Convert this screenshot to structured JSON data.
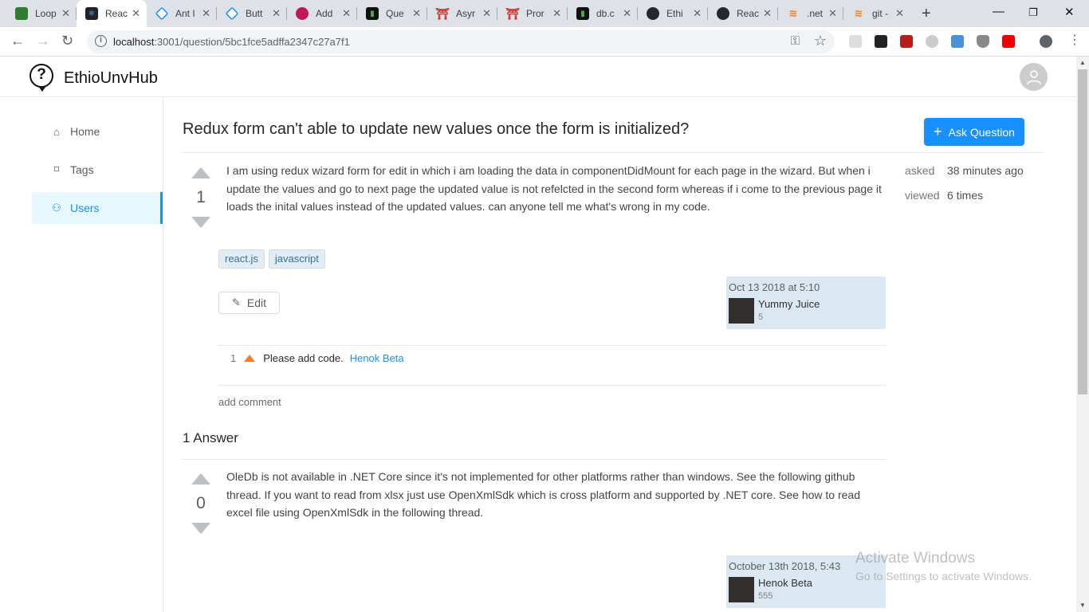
{
  "browser": {
    "tabs": [
      {
        "title": "Loop",
        "color": "#2e7d32"
      },
      {
        "title": "Reac",
        "color": "#20232a"
      },
      {
        "title": "Ant I",
        "color": "#1890ff"
      },
      {
        "title": "Butt",
        "color": "#1890ff"
      },
      {
        "title": "Add",
        "color": "#c2185b"
      },
      {
        "title": "Que",
        "color": "#1b5e20"
      },
      {
        "title": "Asyr",
        "color": "#d32f2f"
      },
      {
        "title": "Pror",
        "color": "#d32f2f"
      },
      {
        "title": "db.c",
        "color": "#1b5e20"
      },
      {
        "title": "Ethi",
        "color": "#24292e"
      },
      {
        "title": "Reac",
        "color": "#24292e"
      },
      {
        "title": ".net",
        "color": "#f48024"
      },
      {
        "title": "git -",
        "color": "#f48024"
      }
    ],
    "active_tab": 1,
    "url_host": "localhost",
    "url_rest": ":3001/question/5bc1fce5adffa2347c27a7f1"
  },
  "app": {
    "brand": "EthioUnvHub"
  },
  "sidebar": {
    "items": [
      {
        "label": "Home",
        "icon": "home-icon"
      },
      {
        "label": "Tags",
        "icon": "tag-icon"
      },
      {
        "label": "Users",
        "icon": "users-icon"
      }
    ],
    "selected": "Users"
  },
  "question": {
    "title": "Redux form can't able to update new values once the form is initialized?",
    "ask_button": "Ask Question",
    "votes": "1",
    "body": "I am using redux wizard form for edit in which i am loading the data in componentDidMount for each page in the wizard. But when i update the values and go to next page the updated value is not refelcted in the second form whereas if i come to the previous page it loads the inital values instead of the updated values. can anyone tell me what's wrong in my code.",
    "asked_label": "asked",
    "asked_value": "38 minutes ago",
    "viewed_label": "viewed",
    "viewed_value": "6 times",
    "tags": [
      "react.js",
      "javascript"
    ],
    "edit_label": "Edit",
    "owner": {
      "when": "Oct 13 2018 at 5:10",
      "name": "Yummy Juice",
      "reputation": "5"
    },
    "comments": [
      {
        "score": "1",
        "text": "Please add code.",
        "user": "Henok Beta"
      }
    ],
    "add_comment": "add comment"
  },
  "answers": {
    "heading": "1 Answer",
    "items": [
      {
        "votes": "0",
        "body": "OleDb is not available in .NET Core since it's not implemented for other platforms rather than windows. See the following github thread. If you want to read from xlsx just use OpenXmlSdk which is cross platform and supported by .NET core. See how to read excel file using OpenXmlSdk in the following thread.",
        "owner": {
          "when": "October 13th 2018, 5:43",
          "name": "Henok Beta",
          "reputation": "555"
        }
      }
    ]
  },
  "watermark": {
    "line1": "Activate Windows",
    "line2": "Go to Settings to activate Windows."
  }
}
